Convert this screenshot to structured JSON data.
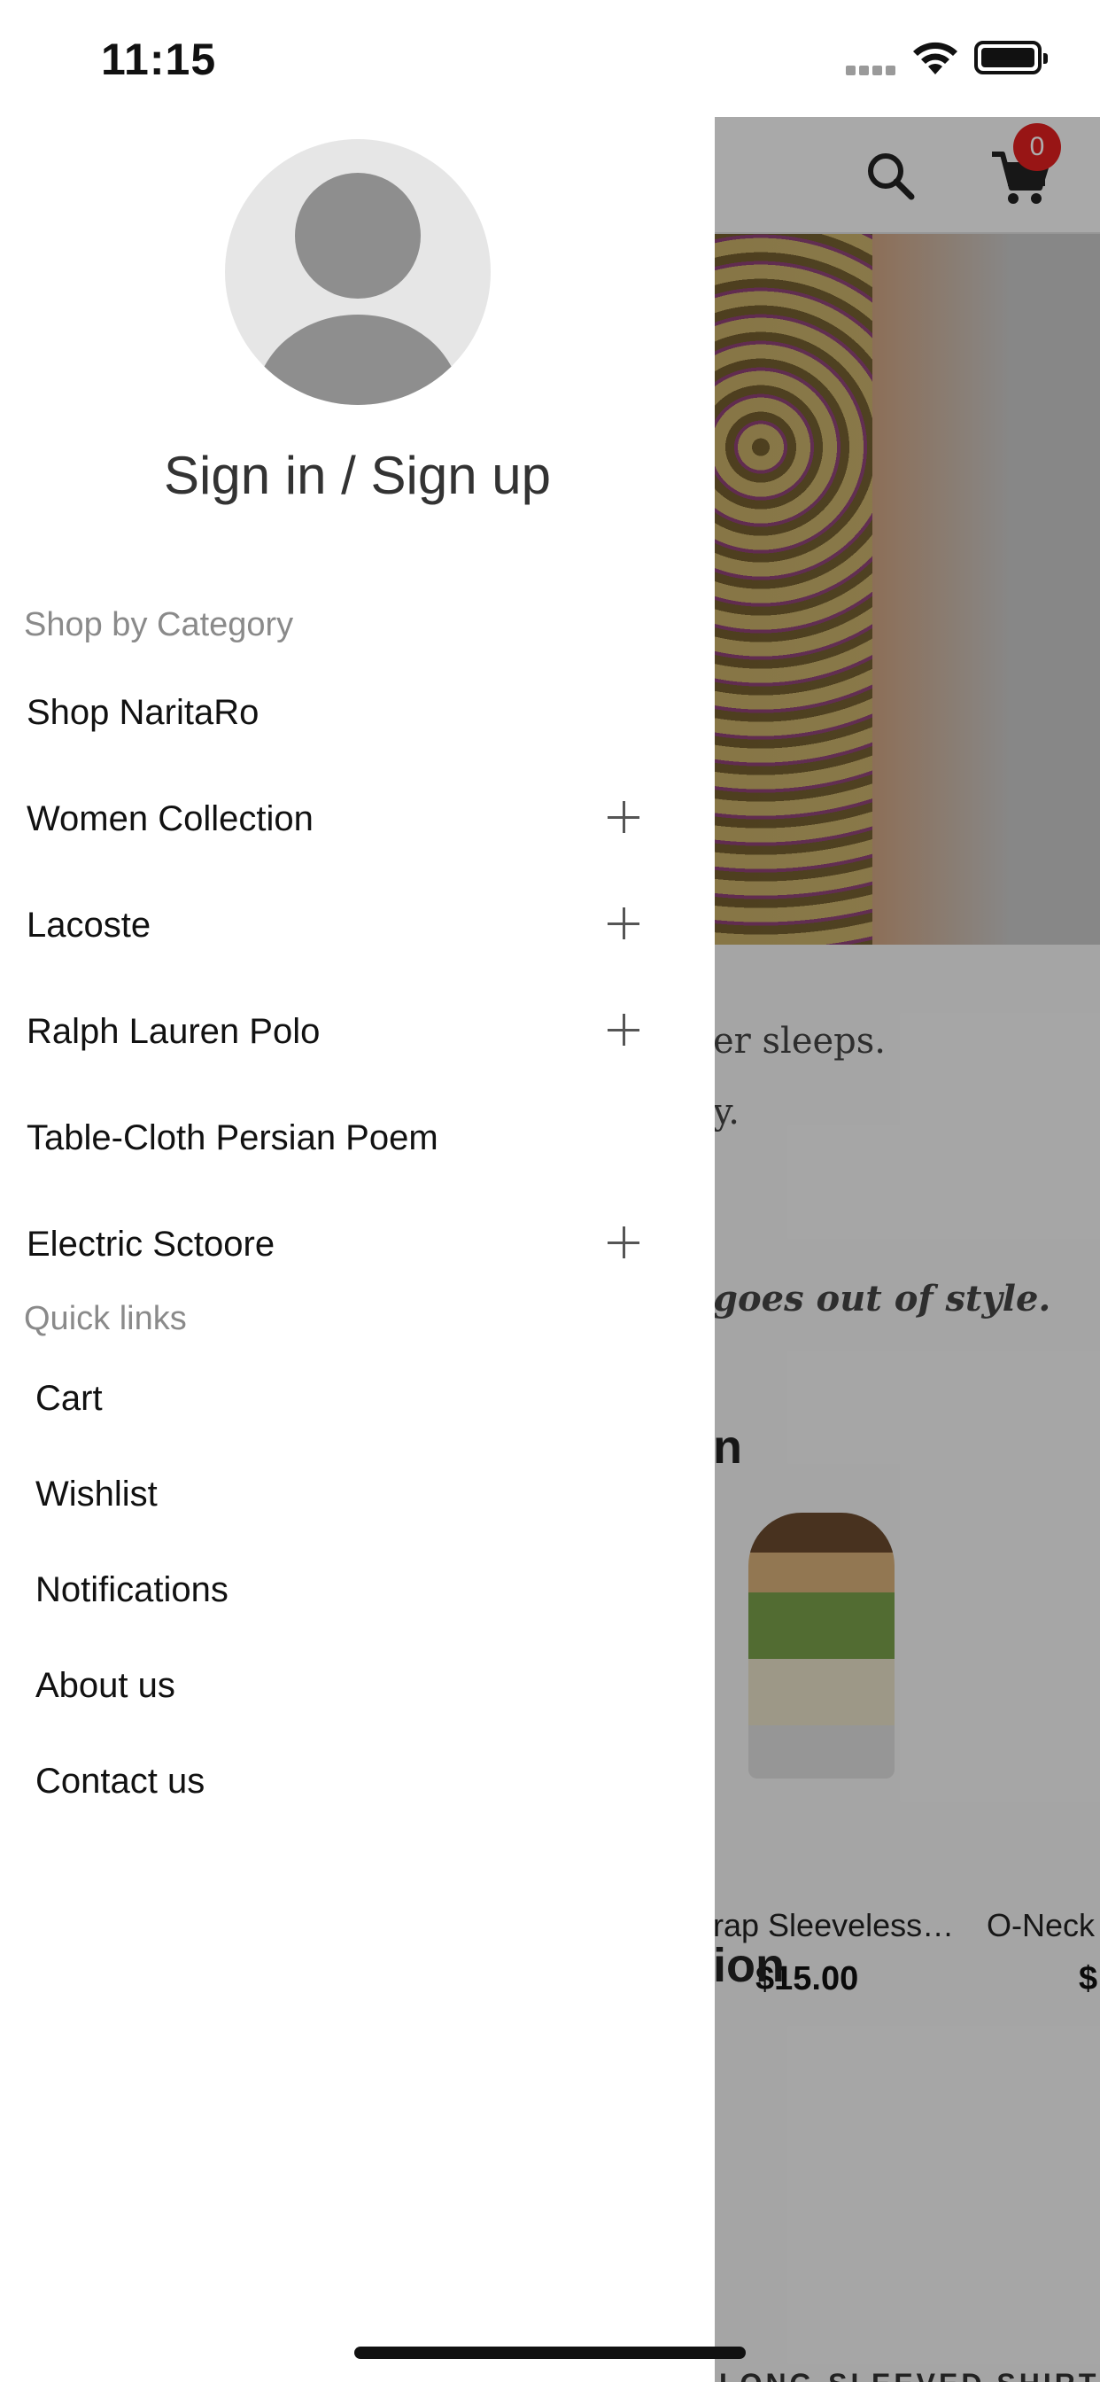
{
  "status_bar": {
    "time": "11:15"
  },
  "background_page": {
    "cart_count": "0",
    "text_lines": [
      "er sleeps.",
      "y.",
      "goes out of style."
    ],
    "heading_1": "n",
    "heading_2": "ion",
    "products": [
      {
        "name": "rap Sleeveless…",
        "price": "$15.00"
      },
      {
        "name": "O-Neck",
        "price": "$"
      }
    ],
    "banner_text": "LONG-SLEEVED SHIRT"
  },
  "drawer": {
    "sign_in_label": "Sign in / Sign up",
    "category_title": "Shop by Category",
    "categories": [
      {
        "label": "Shop NaritaRo",
        "expandable": false
      },
      {
        "label": "Women Collection",
        "expandable": true
      },
      {
        "label": "Lacoste",
        "expandable": true
      },
      {
        "label": "Ralph Lauren Polo",
        "expandable": true
      },
      {
        "label": "Table-Cloth Persian Poem",
        "expandable": false
      },
      {
        "label": "Electric Sctoore",
        "expandable": true
      }
    ],
    "quick_links_title": "Quick links",
    "quick_links": [
      {
        "label": "Cart"
      },
      {
        "label": "Wishlist"
      },
      {
        "label": "Notifications"
      },
      {
        "label": "About us"
      },
      {
        "label": "Contact us"
      }
    ]
  },
  "icons": [
    "wifi-icon",
    "battery-icon",
    "signal-icon",
    "search-icon",
    "cart-icon",
    "avatar-icon",
    "plus-icon"
  ]
}
